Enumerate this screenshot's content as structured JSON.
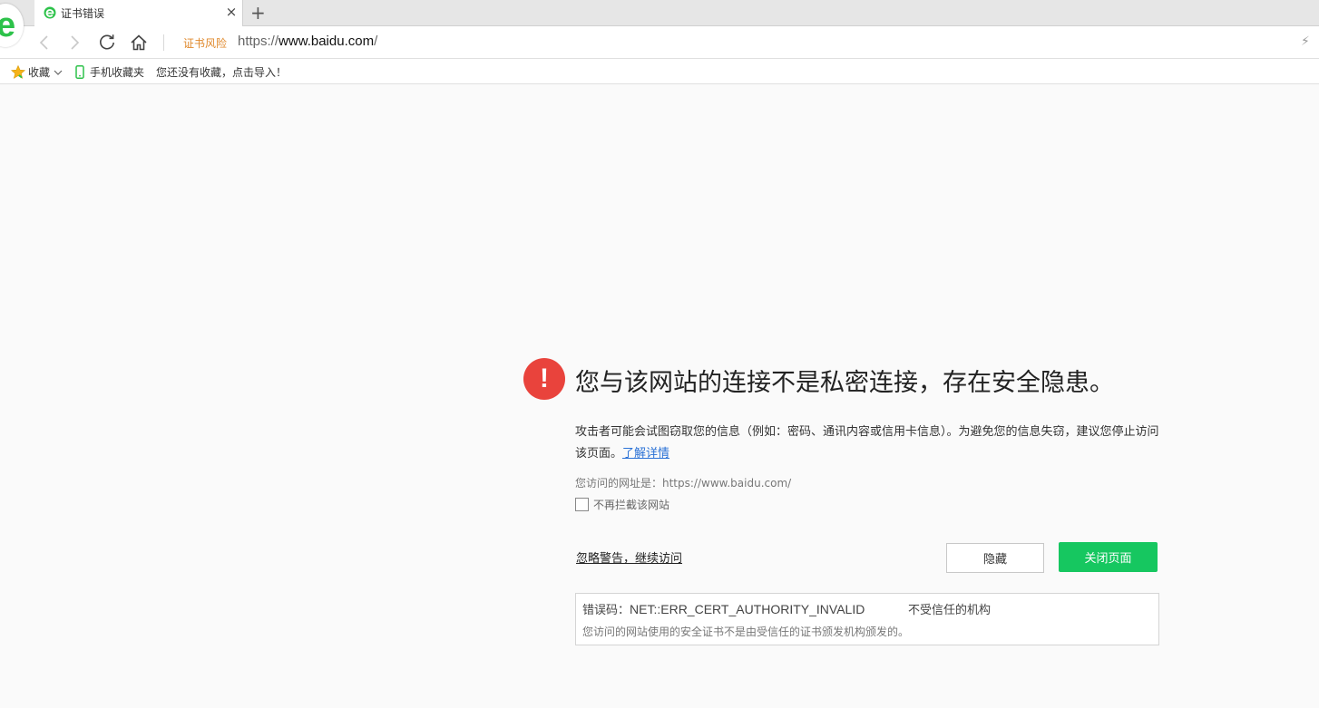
{
  "browser": {
    "tab": {
      "title": "证书错误",
      "close_label": "×"
    },
    "new_tab_label": "+",
    "address": {
      "cert_risk_label": "证书风险",
      "scheme": "https://",
      "host": "www.baidu.com",
      "path": "/"
    },
    "bookmarks": [
      {
        "label": "收藏",
        "icon": "star-icon"
      },
      {
        "label": "手机收藏夹",
        "icon": "phone-icon"
      },
      {
        "label": "您还没有收藏，点击导入！",
        "icon": ""
      }
    ],
    "colors": {
      "brand_green": "#2dc24a",
      "error_red": "#e9433c",
      "close_button_green": "#16c760",
      "link_blue": "#2b72d6",
      "risk_orange": "#e0892c"
    }
  },
  "page": {
    "error_icon": "!",
    "headline": "您与该网站的连接不是私密连接，存在安全隐患。",
    "description": "攻击者可能会试图窃取您的信息（例如：密码、通讯内容或信用卡信息）。为避免您的信息失窃，建议您停止访问该页面。",
    "learn_more_link": "了解详情",
    "visited_url_text": "您访问的网址是：https://www.baidu.com/",
    "no_intercept_label": "不再拦截该网站",
    "ignore_link": "忽略警告，继续访问",
    "hide_button": "隐藏",
    "close_button": "关闭页面",
    "error_box": {
      "code_label": "错误码：",
      "code": "NET::ERR_CERT_AUTHORITY_INVALID",
      "reason": "不受信任的机构",
      "detail": "您访问的网站使用的安全证书不是由受信任的证书颁发机构颁发的。"
    }
  }
}
